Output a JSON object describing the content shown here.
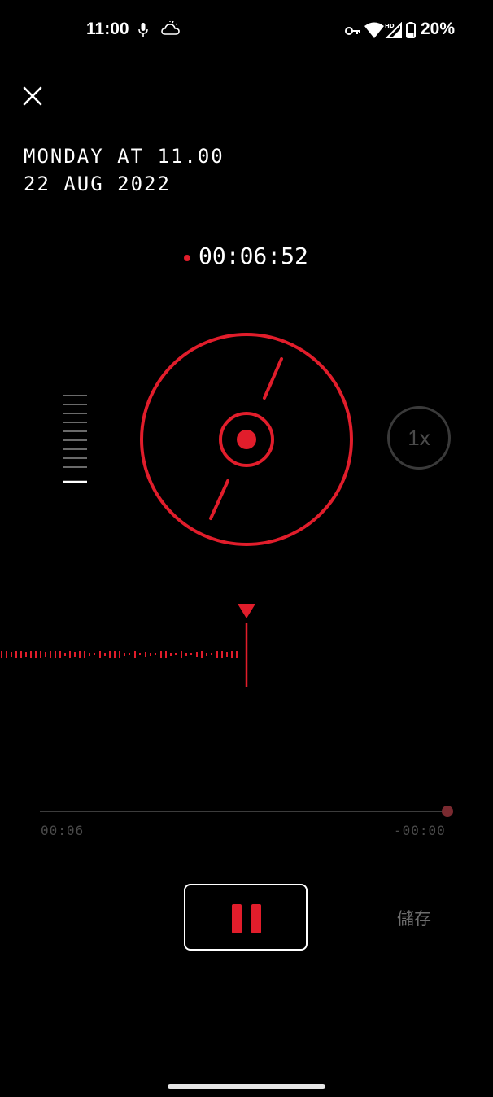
{
  "status_bar": {
    "time": "11:00",
    "battery": "20%",
    "icons": [
      "mic-icon",
      "weather-cloud-icon",
      "vpn-key-icon",
      "wifi-icon",
      "cell-signal-hd-icon",
      "battery-icon"
    ]
  },
  "recording": {
    "title_line_1": "MONDAY AT 11.00",
    "title_line_2": "22 AUG 2022",
    "elapsed": "00:06:52"
  },
  "controls": {
    "speed_label": "1x",
    "elapsed_time": "00:06",
    "remaining_time": "-00:00",
    "save_label": "儲存"
  },
  "progress": {
    "fraction": 1.0
  },
  "colors": {
    "accent_red": "#e11d2b",
    "background": "#000000",
    "muted_gray": "#4a4a4a"
  }
}
